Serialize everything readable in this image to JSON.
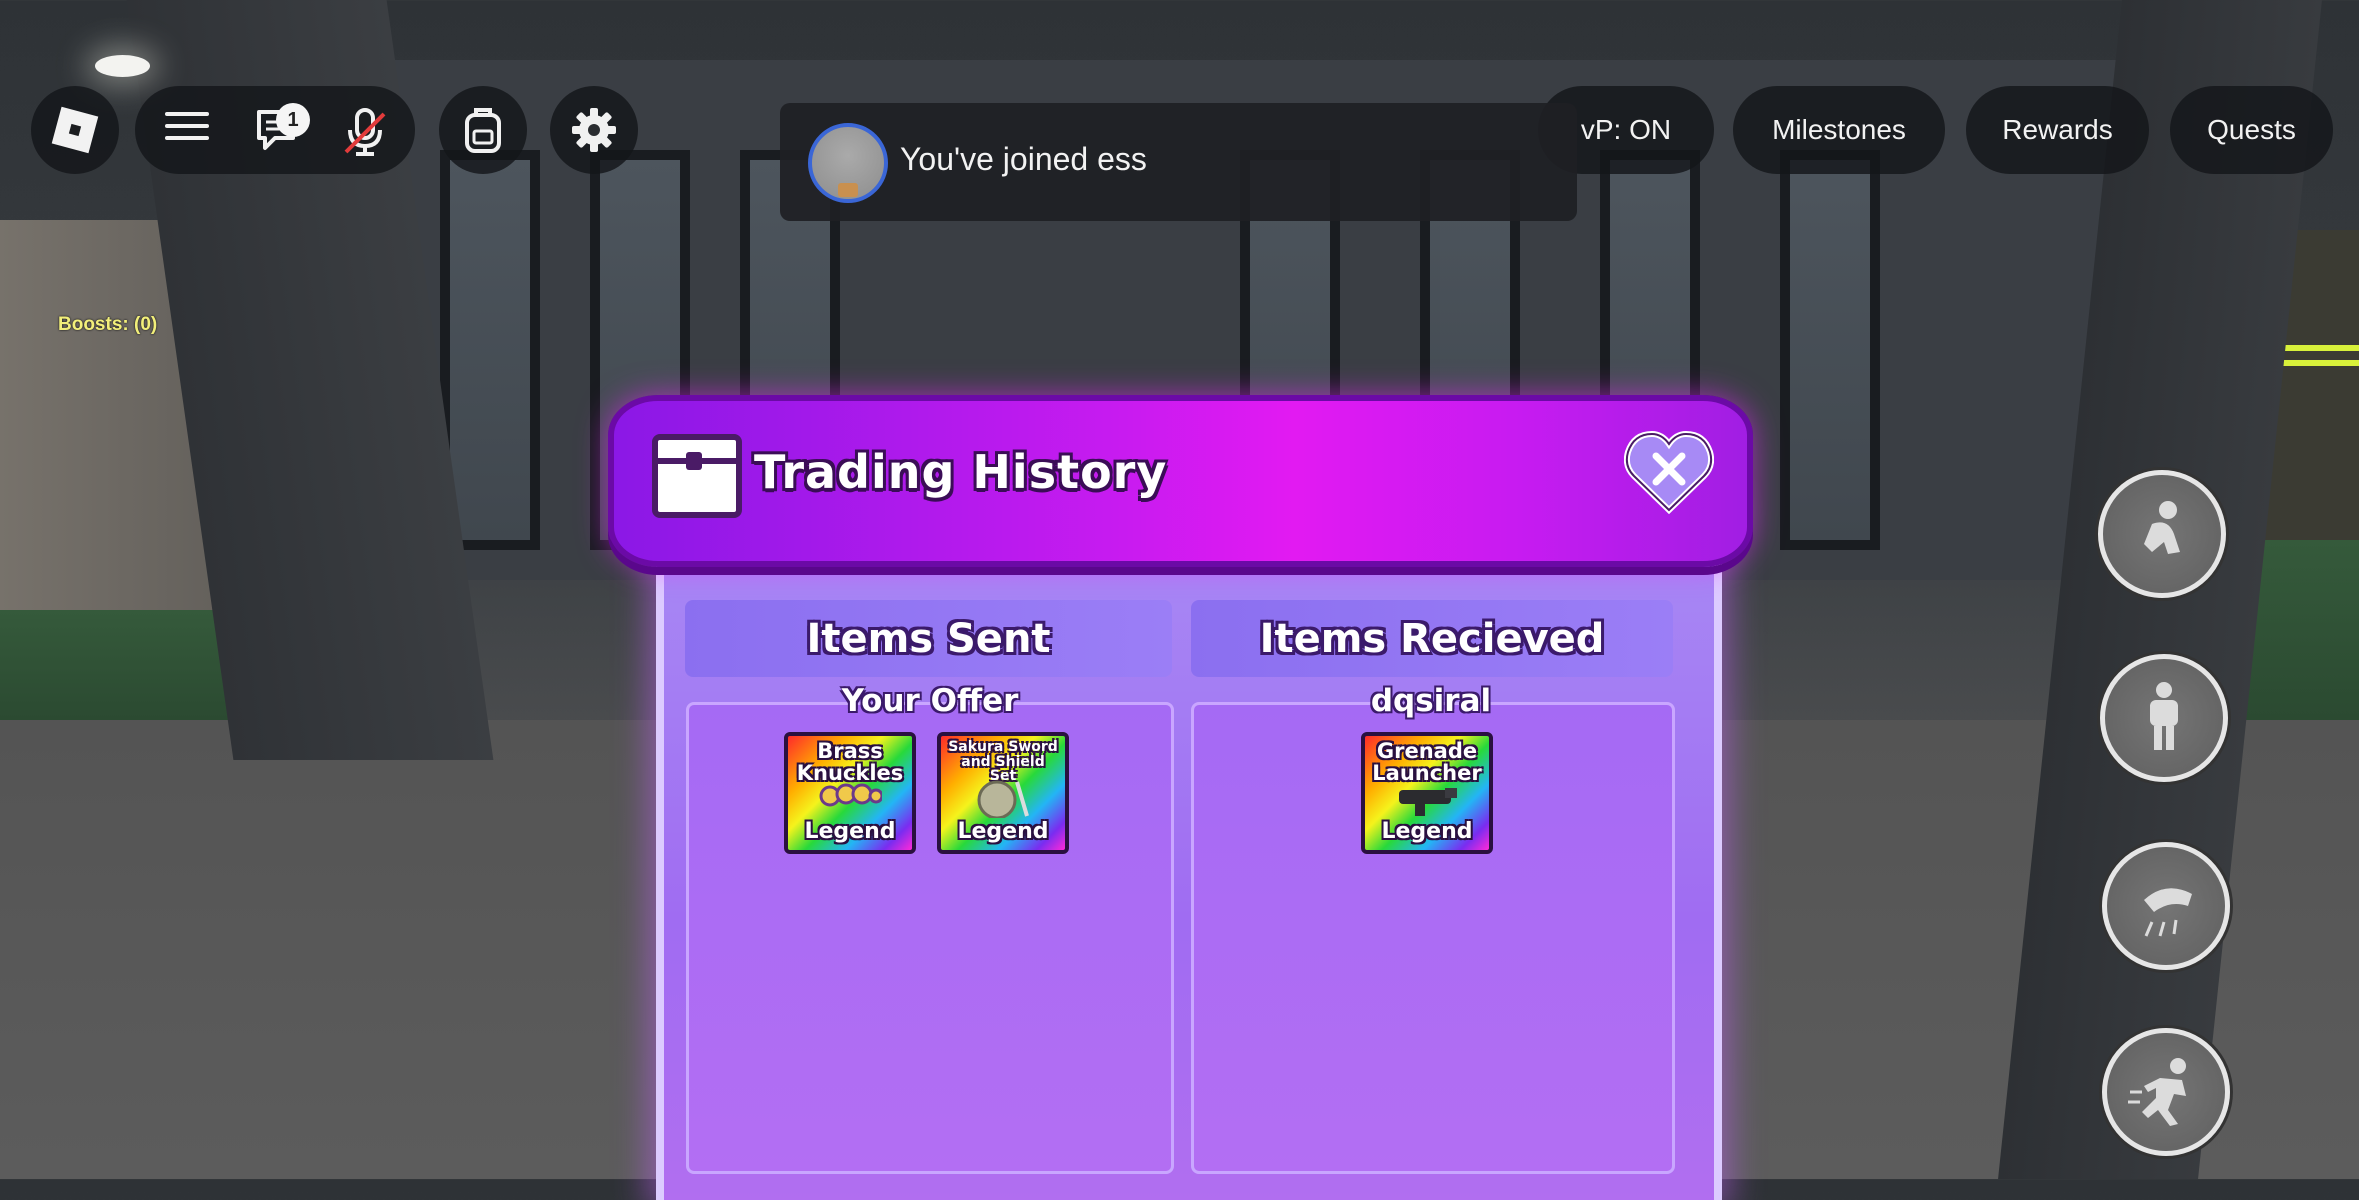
{
  "topbar": {
    "chat_badge_count": "1",
    "buttons": {
      "pvp": "vP: ON",
      "milestones": "Milestones",
      "rewards": "Rewards",
      "quests": "Quests"
    }
  },
  "toast": {
    "message": "You've joined ess"
  },
  "hud": {
    "boosts": "Boosts: (0)"
  },
  "trading_history": {
    "title": "Trading History",
    "sent": {
      "heading": "Items Sent",
      "label": "Your Offer",
      "items": [
        {
          "name": "Brass Knuckles",
          "rarity": "Legend",
          "icon": "brass-knuckles-icon"
        },
        {
          "name": "Sakura Sword and Shield Set",
          "rarity": "Legend",
          "icon": "sakura-sword-shield-icon"
        }
      ]
    },
    "received": {
      "heading": "Items Recieved",
      "label": "dqsiral",
      "items": [
        {
          "name": "Grenade Launcher",
          "rarity": "Legend",
          "icon": "grenade-launcher-icon"
        }
      ]
    }
  },
  "side_actions": [
    "crouch-icon",
    "carry-icon",
    "dash-icon",
    "sprint-icon"
  ],
  "colors": {
    "header_accent": "#e21af2",
    "panel": "#a56af4",
    "rarity_text": "#ffffff"
  }
}
